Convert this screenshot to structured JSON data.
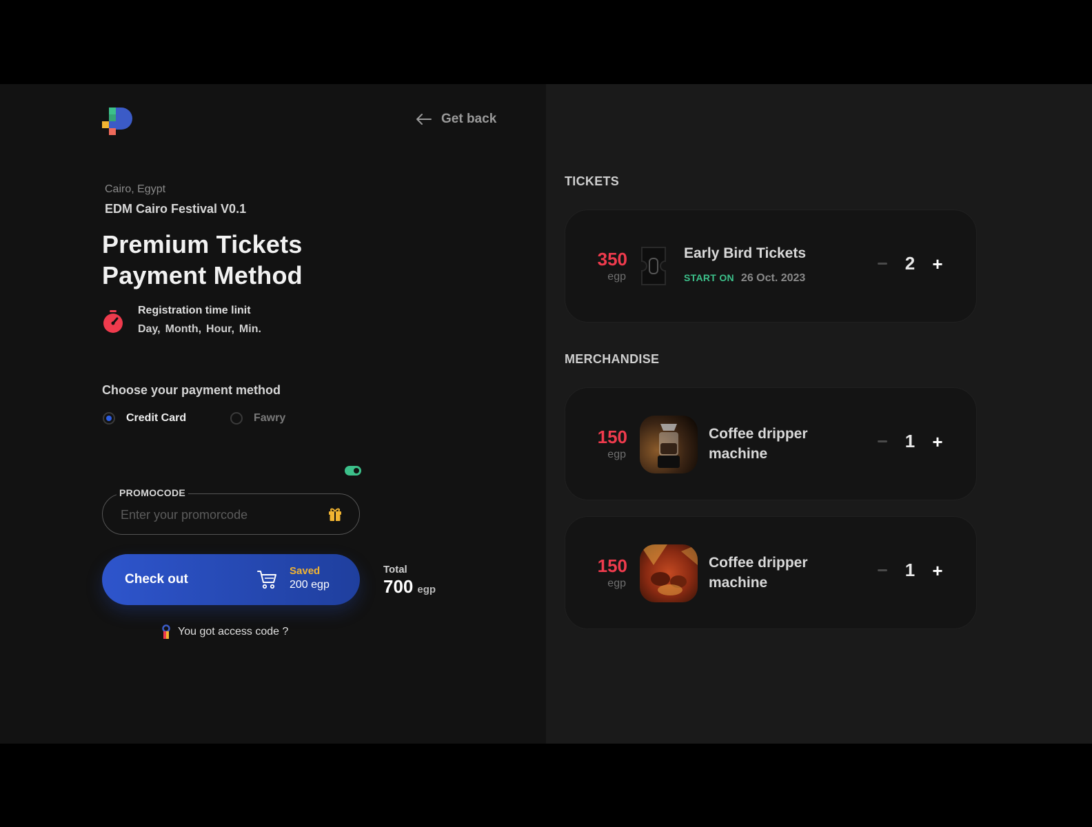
{
  "header": {
    "back_label": "Get back"
  },
  "event": {
    "location": "Cairo, Egypt",
    "name": "EDM Cairo Festival V0.1",
    "title_line1": "Premium Tickets",
    "title_line2": "Payment Method"
  },
  "timer": {
    "title": "Registration time linit",
    "units": [
      "Day,",
      "Month,",
      "Hour,",
      "Min."
    ]
  },
  "payment": {
    "title": "Choose your payment method",
    "options": [
      {
        "label": "Credit Card",
        "selected": true
      },
      {
        "label": "Fawry",
        "selected": false
      }
    ]
  },
  "promo": {
    "enabled": true,
    "label": "PROMOCODE",
    "placeholder": "Enter your promorcode",
    "value": ""
  },
  "checkout": {
    "label": "Check out",
    "saved_label": "Saved",
    "saved_amount": "200 egp"
  },
  "total": {
    "label": "Total",
    "value": "700",
    "currency": "egp"
  },
  "access": {
    "label": "You got access code ?"
  },
  "tickets": {
    "title": "TICKETS",
    "items": [
      {
        "price": "350",
        "currency": "egp",
        "name": "Early Bird Tickets",
        "start_label": "START ON",
        "start_date": "26 Oct. 2023",
        "qty": "2",
        "icon": "ticket-icon"
      }
    ]
  },
  "merchandise": {
    "title": "MERCHANDISE",
    "items": [
      {
        "price": "150",
        "currency": "egp",
        "name_line1": "Coffee dripper",
        "name_line2": "machine",
        "qty": "1",
        "image": "coffee-dripper-photo"
      },
      {
        "price": "150",
        "currency": "egp",
        "name_line1": "Coffee dripper",
        "name_line2": "machine",
        "qty": "1",
        "image": "coffee-beans-photo"
      }
    ]
  },
  "colors": {
    "accent_blue": "#2e55cc",
    "price_red": "#ef3b4d",
    "green": "#3cc08a",
    "saved_yellow": "#f2b431",
    "bg_left": "#121212",
    "bg_right": "#1a1a1a"
  }
}
